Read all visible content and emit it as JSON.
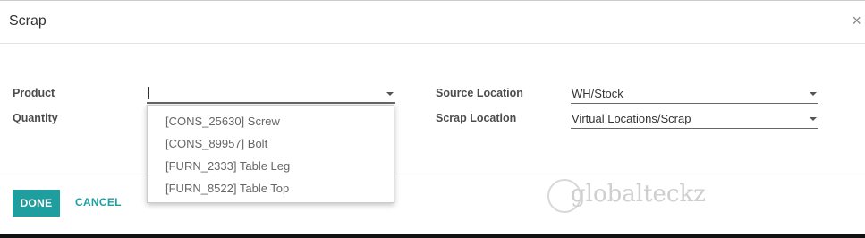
{
  "dialog": {
    "title": "Scrap",
    "close_glyph": "×"
  },
  "form": {
    "product_label": "Product",
    "product_value": "",
    "quantity_label": "Quantity",
    "source_location_label": "Source Location",
    "source_location_value": "WH/Stock",
    "scrap_location_label": "Scrap Location",
    "scrap_location_value": "Virtual Locations/Scrap"
  },
  "product_dropdown": {
    "options": [
      "[CONS_25630] Screw",
      "[CONS_89957] Bolt",
      "[FURN_2333] Table Leg",
      "[FURN_8522] Table Top"
    ]
  },
  "footer": {
    "done_label": "DONE",
    "cancel_label": "CANCEL"
  },
  "watermark": {
    "text": "globalteckz"
  },
  "colors": {
    "accent": "#1e9e9e",
    "label": "#4c4c4c",
    "option_text": "#666666"
  },
  "icons": {
    "close": "close-icon",
    "dropdown": "chevron-down-icon"
  }
}
